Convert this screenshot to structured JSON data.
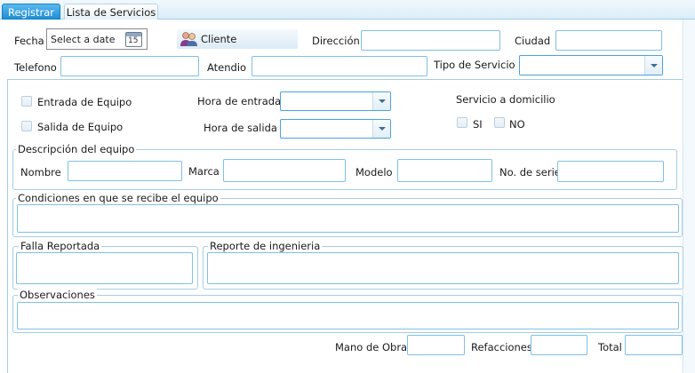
{
  "tabs": [
    {
      "label": "Registrar",
      "active": true
    },
    {
      "label": "Lista de Servicios",
      "active": false
    }
  ],
  "header": {
    "fecha_label": "Fecha",
    "date_placeholder": "Select a date",
    "calendar_day": "15",
    "cliente_label": "Cliente",
    "direccion_label": "Dirección",
    "ciudad_label": "Ciudad",
    "telefono_label": "Telefono",
    "atendio_label": "Atendio",
    "tipo_servicio_label": "Tipo de Servicio"
  },
  "equipo": {
    "entrada_label": "Entrada de Equipo",
    "salida_label": "Salida de Equipo",
    "hora_entrada_label": "Hora de entrada",
    "hora_salida_label": "Hora de salida",
    "domicilio_label": "Servicio a domicilio",
    "si_label": "SI",
    "no_label": "NO"
  },
  "descripcion": {
    "legend": "Descripción del equipo",
    "nombre_label": "Nombre",
    "marca_label": "Marca",
    "modelo_label": "Modelo",
    "serie_label": "No. de serie"
  },
  "condiciones": {
    "legend": "Condiciones en que se recibe el equipo"
  },
  "falla": {
    "legend": "Falla Reportada"
  },
  "reporte": {
    "legend": "Reporte de ingenieria"
  },
  "observaciones": {
    "legend": "Observaciones"
  },
  "totales": {
    "mano_obra_label": "Mano de Obra",
    "refacciones_label": "Refacciones",
    "total_label": "Total"
  },
  "colors": {
    "accent": "#1e9be0",
    "border": "#7fc0e8",
    "tab_strip": "#e6f2fa"
  }
}
